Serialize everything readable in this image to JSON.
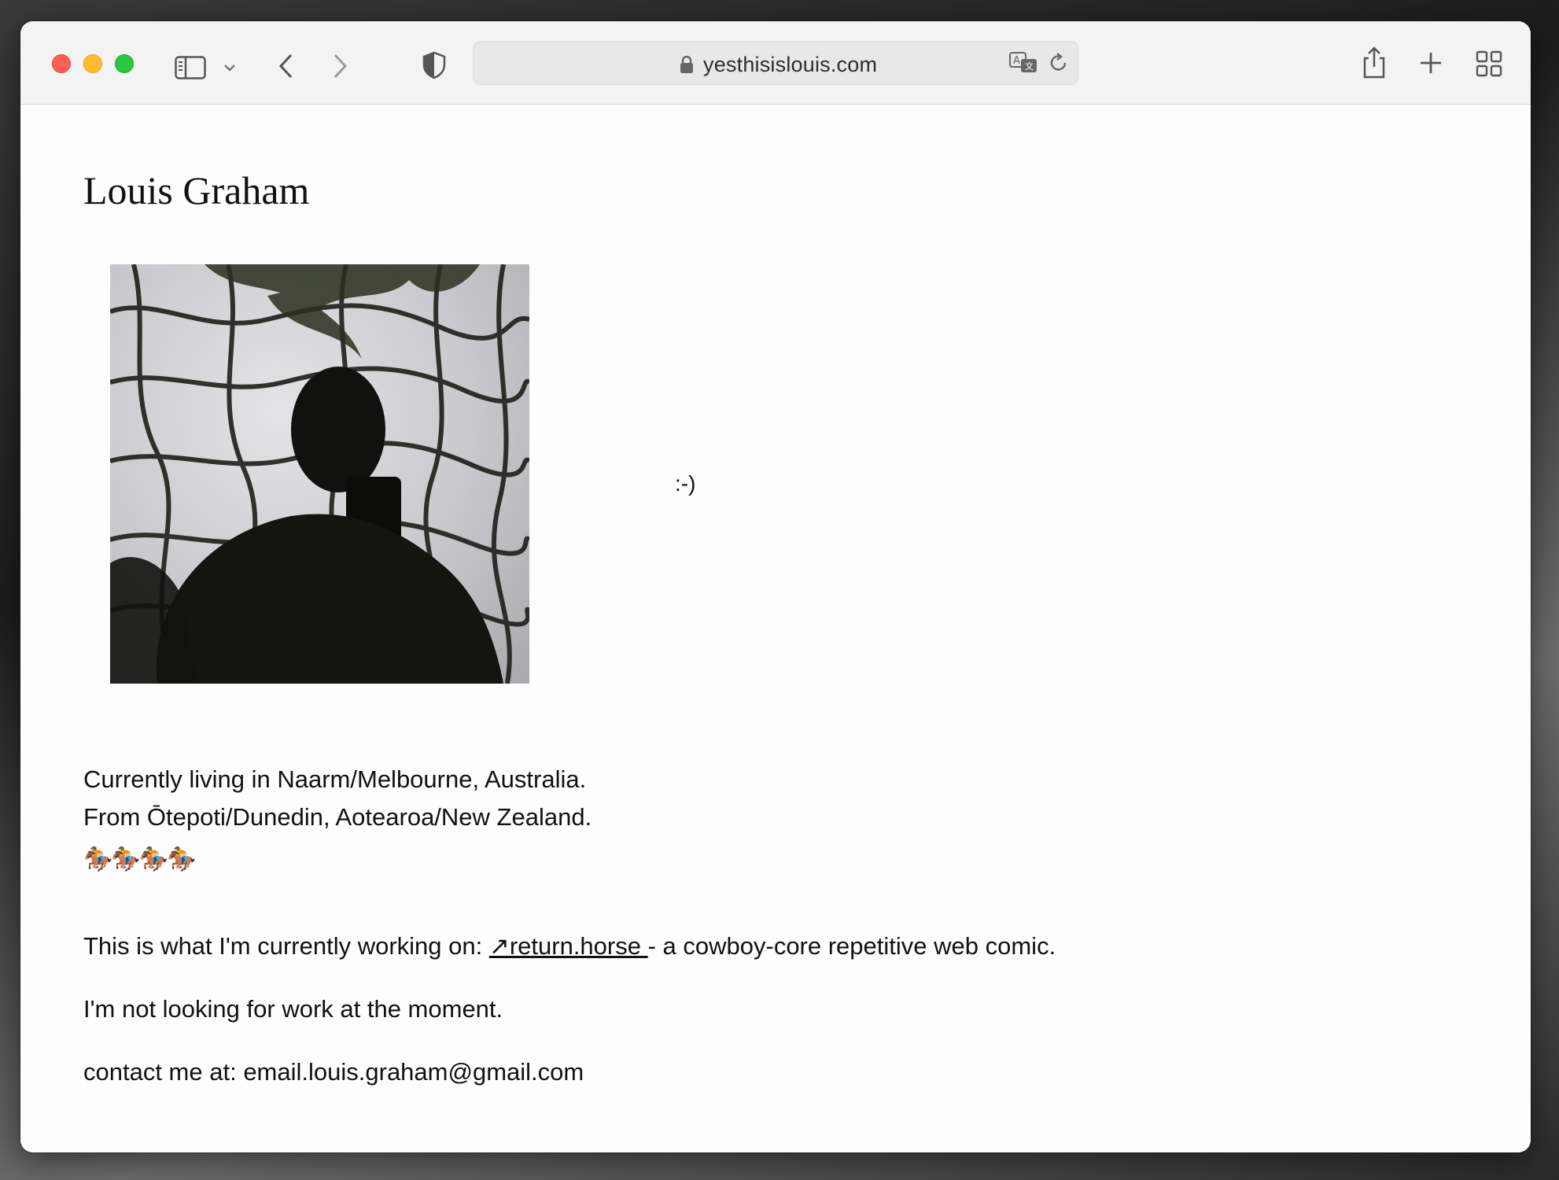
{
  "browser": {
    "url": "yesthisislouis.com"
  },
  "page": {
    "title": "Louis Graham",
    "smiley": ":-)",
    "location_line1": "Currently living in Naarm/Melbourne, Australia.",
    "location_line2": "From Ōtepoti/Dunedin, Aotearoa/New Zealand.",
    "horses": "🏇🏇🏇🏇",
    "working_prefix": "This is what I'm currently working on: ",
    "working_link": "↗return.horse ",
    "working_suffix": "- a cowboy-core repetitive web comic.",
    "availability": "I'm not looking for work at the moment.",
    "contact": "contact me at: email.louis.graham@gmail.com"
  },
  "colors": {
    "close": "#fe5f57",
    "minimize": "#febc2e",
    "maximize": "#28c840",
    "text": "#111111"
  },
  "icons": [
    "sidebar-icon",
    "chevron-down-icon",
    "back-icon",
    "forward-icon",
    "shield-icon",
    "lock-icon",
    "translate-icon",
    "reload-icon",
    "share-icon",
    "plus-icon",
    "tab-overview-icon"
  ]
}
